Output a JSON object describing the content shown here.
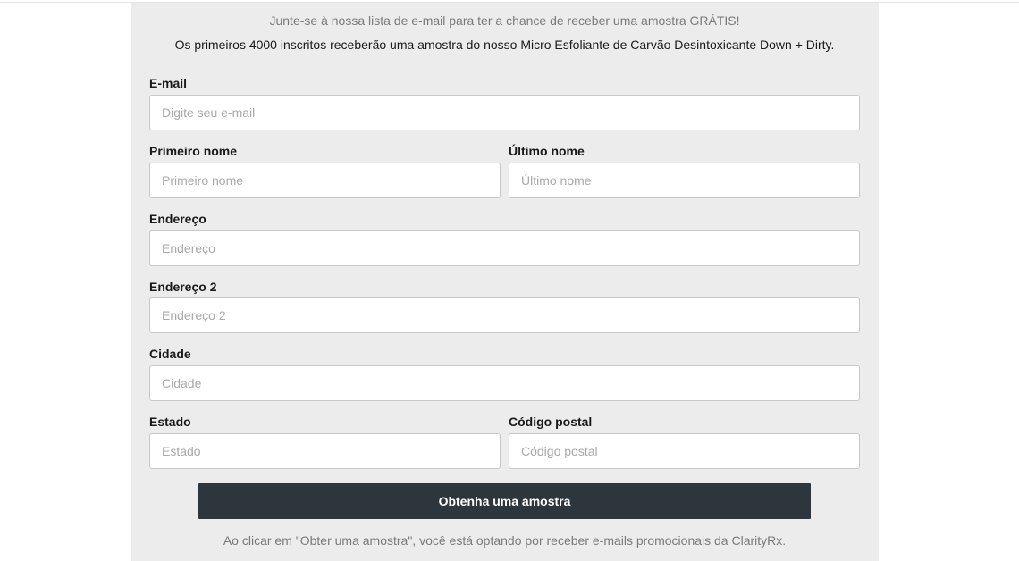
{
  "intro": {
    "headline": "Junte-se à nossa lista de e-mail para ter a chance de receber uma amostra GRÁTIS!",
    "subline": "Os primeiros 4000 inscritos receberão uma amostra do nosso Micro Esfoliante de Carvão Desintoxicante Down + Dirty."
  },
  "form": {
    "email": {
      "label": "E-mail",
      "placeholder": "Digite seu e-mail",
      "value": ""
    },
    "first_name": {
      "label": "Primeiro nome",
      "placeholder": "Primeiro nome",
      "value": ""
    },
    "last_name": {
      "label": "Último nome",
      "placeholder": "Último nome",
      "value": ""
    },
    "address": {
      "label": "Endereço",
      "placeholder": "Endereço",
      "value": ""
    },
    "address2": {
      "label": "Endereço 2",
      "placeholder": "Endereço 2",
      "value": ""
    },
    "city": {
      "label": "Cidade",
      "placeholder": "Cidade",
      "value": ""
    },
    "state": {
      "label": "Estado",
      "placeholder": "Estado",
      "value": ""
    },
    "postal_code": {
      "label": "Código postal",
      "placeholder": "Código postal",
      "value": ""
    },
    "submit_label": "Obtenha uma amostra",
    "disclaimer": "Ao clicar em \"Obter uma amostra\", você está optando por receber e-mails promocionais da ClarityRx."
  },
  "colors": {
    "panel_background": "#ececec",
    "button_background": "#2d363d",
    "button_text": "#ffffff",
    "muted_text": "#7a7a7a"
  }
}
